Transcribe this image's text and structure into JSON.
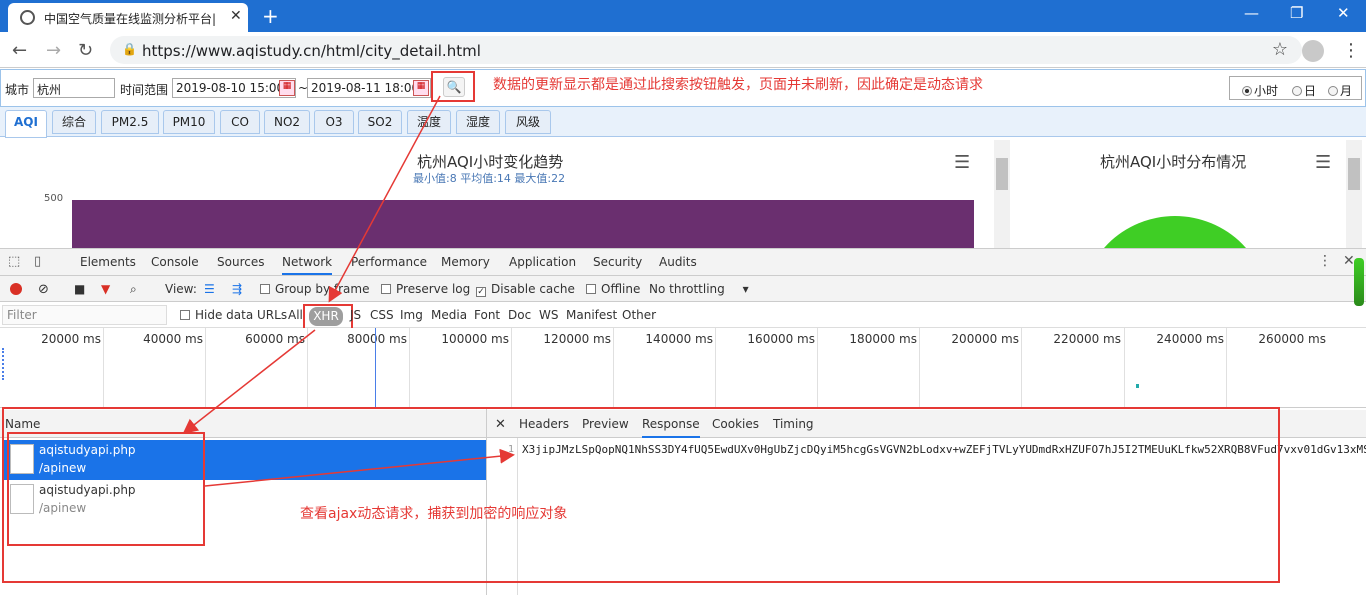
{
  "browser": {
    "tab_title": "中国空气质量在线监测分析平台|",
    "url": "https://www.aqistudy.cn/html/city_detail.html"
  },
  "query": {
    "city_label": "城市",
    "city_value": "杭州",
    "time_label": "时间范围",
    "start": "2019-08-10 15:00",
    "tilde": "~",
    "end": "2019-08-11 18:00",
    "radios": [
      "小时",
      "日",
      "月"
    ],
    "selected_radio": "小时"
  },
  "annotations": {
    "note1": "数据的更新显示都是通过此搜索按钮触发，页面并未刷新，因此确定是动态请求",
    "note2": "查看ajax动态请求，捕获到加密的响应对象"
  },
  "data_tabs": [
    "AQI",
    "综合",
    "PM2.5",
    "PM10",
    "CO",
    "NO2",
    "O3",
    "SO2",
    "温度",
    "湿度",
    "风级"
  ],
  "charts": {
    "trend_title": "杭州AQI小时变化趋势",
    "trend_sub": "最小值:8 平均值:14 最大值:22",
    "ytick": "500",
    "dist_title": "杭州AQI小时分布情况"
  },
  "devtools": {
    "tabs": [
      "Elements",
      "Console",
      "Sources",
      "Network",
      "Performance",
      "Memory",
      "Application",
      "Security",
      "Audits"
    ],
    "active_tab": "Network",
    "toolbar": {
      "view": "View:",
      "group": "Group by frame",
      "preserve": "Preserve log",
      "cache": "Disable cache",
      "offline": "Offline",
      "throttle": "No throttling"
    },
    "filter_placeholder": "Filter",
    "hide_data": "Hide data URLs",
    "types": [
      "All",
      "XHR",
      "JS",
      "CSS",
      "Img",
      "Media",
      "Font",
      "Doc",
      "WS",
      "Manifest",
      "Other"
    ],
    "timeline": [
      "20000 ms",
      "40000 ms",
      "60000 ms",
      "80000 ms",
      "100000 ms",
      "120000 ms",
      "140000 ms",
      "160000 ms",
      "180000 ms",
      "200000 ms",
      "220000 ms",
      "240000 ms",
      "260000 ms"
    ],
    "name_header": "Name",
    "requests": [
      {
        "name": "aqistudyapi.php",
        "path": "/apinew"
      },
      {
        "name": "aqistudyapi.php",
        "path": "/apinew"
      }
    ],
    "response_tabs": [
      "Headers",
      "Preview",
      "Response",
      "Cookies",
      "Timing"
    ],
    "line_number": "1",
    "response_text": "X3jipJMzLSpQopNQ1NhSS3DY4fUQ5EwdUXv0HgUbZjcDQyiM5hcgGsVGVN2bLodxv+wZEFjTVLyYUDmdRxHZUFO7hJ5I2TMEUuKLfkw52XRQB8VFud7vxv01dGv13xMS"
  }
}
